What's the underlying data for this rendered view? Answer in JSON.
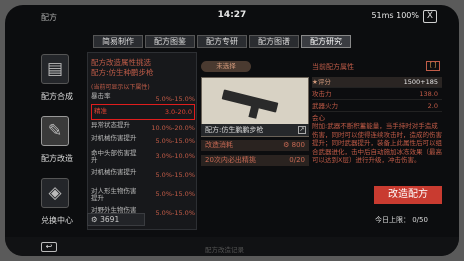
{
  "status": {
    "app": "配方",
    "time": "14:27",
    "right": "51ms 100%",
    "close": "X"
  },
  "tabs": [
    "简易制作",
    "配方图鉴",
    "配方专研",
    "配方图谱",
    "配方研究"
  ],
  "side": [
    {
      "label": "配方合成",
      "icon": "desk-icon"
    },
    {
      "label": "配方改造",
      "icon": "document-icon"
    },
    {
      "label": "兑换中心",
      "icon": "bag-icon"
    }
  ],
  "stats": {
    "title1": "配方改造属性挑选",
    "title2": "配方:仿生种鹏步枪",
    "note": "(当前可显示以下属性)",
    "rows": [
      {
        "k": "暴击率",
        "v": "5.0%-15.0%"
      },
      {
        "k": "精准",
        "v": "3.0-20.0"
      },
      {
        "k": "异常状态提升",
        "v": "10.0%-20.0%"
      },
      {
        "k": "对机械伤害提升",
        "v": "5.0%-15.0%"
      },
      {
        "k": "命中头部伤害提升",
        "v": "3.0%-10.0%"
      },
      {
        "k": "对机械伤害提升",
        "v": "5.0%-15.0%"
      },
      {
        "k": "对人形生物伤害提升",
        "v": "5.0%-15.0%"
      },
      {
        "k": "对野外生物伤害提升",
        "v": "5.0%-15.0%"
      }
    ],
    "dust": "3691"
  },
  "middle": {
    "pill": "未选择",
    "name": "配方:仿生鹏鹏步枪",
    "rows": [
      {
        "k": "改造消耗",
        "v": "800"
      },
      {
        "k": "20次内必出精挑",
        "v": "0/20"
      }
    ]
  },
  "right": {
    "header": "当前配方属性",
    "expand": "[ ]",
    "rows": [
      {
        "k": "评分",
        "v": "1500+185"
      },
      {
        "k": "攻击力",
        "v": "138.0"
      },
      {
        "k": "武器火力",
        "v": "2.0"
      },
      {
        "k": "会心",
        "v": ""
      }
    ],
    "desc": "附加:武器不断积蓄能量，当手持时对手造成伤害，同时可以使得连续攻击时，造成的伤害提升；同时武器提升，装备上此属性后可以组合武器进化，击中后自动施加冰冻效果（最高可以达到X层）进行升级，冲击伤害。",
    "craft": "改造配方",
    "today": "今日上限： 0/50"
  },
  "nav": {
    "back": "↩",
    "hint": "配方改造记录"
  }
}
